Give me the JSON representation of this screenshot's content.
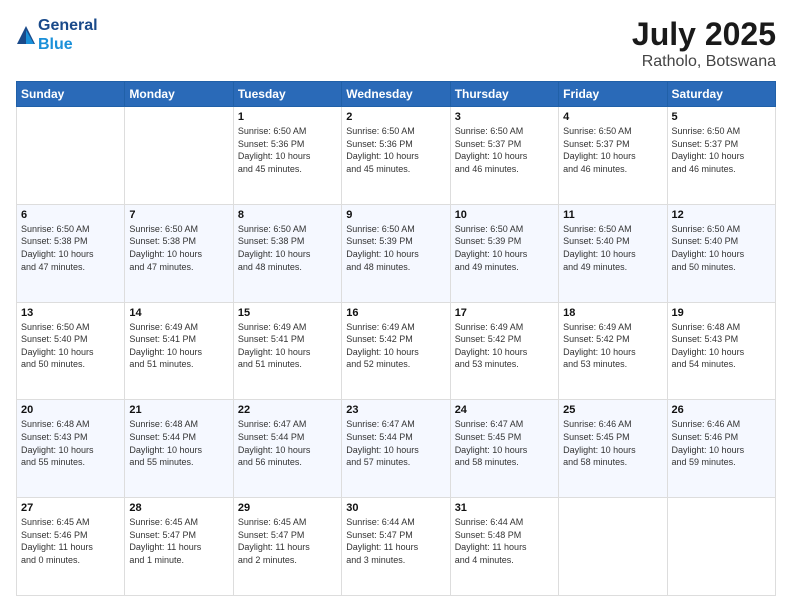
{
  "header": {
    "logo_line1": "General",
    "logo_line2": "Blue",
    "month": "July 2025",
    "location": "Ratholo, Botswana"
  },
  "days_of_week": [
    "Sunday",
    "Monday",
    "Tuesday",
    "Wednesday",
    "Thursday",
    "Friday",
    "Saturday"
  ],
  "weeks": [
    [
      {
        "day": "",
        "info": ""
      },
      {
        "day": "",
        "info": ""
      },
      {
        "day": "1",
        "info": "Sunrise: 6:50 AM\nSunset: 5:36 PM\nDaylight: 10 hours\nand 45 minutes."
      },
      {
        "day": "2",
        "info": "Sunrise: 6:50 AM\nSunset: 5:36 PM\nDaylight: 10 hours\nand 45 minutes."
      },
      {
        "day": "3",
        "info": "Sunrise: 6:50 AM\nSunset: 5:37 PM\nDaylight: 10 hours\nand 46 minutes."
      },
      {
        "day": "4",
        "info": "Sunrise: 6:50 AM\nSunset: 5:37 PM\nDaylight: 10 hours\nand 46 minutes."
      },
      {
        "day": "5",
        "info": "Sunrise: 6:50 AM\nSunset: 5:37 PM\nDaylight: 10 hours\nand 46 minutes."
      }
    ],
    [
      {
        "day": "6",
        "info": "Sunrise: 6:50 AM\nSunset: 5:38 PM\nDaylight: 10 hours\nand 47 minutes."
      },
      {
        "day": "7",
        "info": "Sunrise: 6:50 AM\nSunset: 5:38 PM\nDaylight: 10 hours\nand 47 minutes."
      },
      {
        "day": "8",
        "info": "Sunrise: 6:50 AM\nSunset: 5:38 PM\nDaylight: 10 hours\nand 48 minutes."
      },
      {
        "day": "9",
        "info": "Sunrise: 6:50 AM\nSunset: 5:39 PM\nDaylight: 10 hours\nand 48 minutes."
      },
      {
        "day": "10",
        "info": "Sunrise: 6:50 AM\nSunset: 5:39 PM\nDaylight: 10 hours\nand 49 minutes."
      },
      {
        "day": "11",
        "info": "Sunrise: 6:50 AM\nSunset: 5:40 PM\nDaylight: 10 hours\nand 49 minutes."
      },
      {
        "day": "12",
        "info": "Sunrise: 6:50 AM\nSunset: 5:40 PM\nDaylight: 10 hours\nand 50 minutes."
      }
    ],
    [
      {
        "day": "13",
        "info": "Sunrise: 6:50 AM\nSunset: 5:40 PM\nDaylight: 10 hours\nand 50 minutes."
      },
      {
        "day": "14",
        "info": "Sunrise: 6:49 AM\nSunset: 5:41 PM\nDaylight: 10 hours\nand 51 minutes."
      },
      {
        "day": "15",
        "info": "Sunrise: 6:49 AM\nSunset: 5:41 PM\nDaylight: 10 hours\nand 51 minutes."
      },
      {
        "day": "16",
        "info": "Sunrise: 6:49 AM\nSunset: 5:42 PM\nDaylight: 10 hours\nand 52 minutes."
      },
      {
        "day": "17",
        "info": "Sunrise: 6:49 AM\nSunset: 5:42 PM\nDaylight: 10 hours\nand 53 minutes."
      },
      {
        "day": "18",
        "info": "Sunrise: 6:49 AM\nSunset: 5:42 PM\nDaylight: 10 hours\nand 53 minutes."
      },
      {
        "day": "19",
        "info": "Sunrise: 6:48 AM\nSunset: 5:43 PM\nDaylight: 10 hours\nand 54 minutes."
      }
    ],
    [
      {
        "day": "20",
        "info": "Sunrise: 6:48 AM\nSunset: 5:43 PM\nDaylight: 10 hours\nand 55 minutes."
      },
      {
        "day": "21",
        "info": "Sunrise: 6:48 AM\nSunset: 5:44 PM\nDaylight: 10 hours\nand 55 minutes."
      },
      {
        "day": "22",
        "info": "Sunrise: 6:47 AM\nSunset: 5:44 PM\nDaylight: 10 hours\nand 56 minutes."
      },
      {
        "day": "23",
        "info": "Sunrise: 6:47 AM\nSunset: 5:44 PM\nDaylight: 10 hours\nand 57 minutes."
      },
      {
        "day": "24",
        "info": "Sunrise: 6:47 AM\nSunset: 5:45 PM\nDaylight: 10 hours\nand 58 minutes."
      },
      {
        "day": "25",
        "info": "Sunrise: 6:46 AM\nSunset: 5:45 PM\nDaylight: 10 hours\nand 58 minutes."
      },
      {
        "day": "26",
        "info": "Sunrise: 6:46 AM\nSunset: 5:46 PM\nDaylight: 10 hours\nand 59 minutes."
      }
    ],
    [
      {
        "day": "27",
        "info": "Sunrise: 6:45 AM\nSunset: 5:46 PM\nDaylight: 11 hours\nand 0 minutes."
      },
      {
        "day": "28",
        "info": "Sunrise: 6:45 AM\nSunset: 5:47 PM\nDaylight: 11 hours\nand 1 minute."
      },
      {
        "day": "29",
        "info": "Sunrise: 6:45 AM\nSunset: 5:47 PM\nDaylight: 11 hours\nand 2 minutes."
      },
      {
        "day": "30",
        "info": "Sunrise: 6:44 AM\nSunset: 5:47 PM\nDaylight: 11 hours\nand 3 minutes."
      },
      {
        "day": "31",
        "info": "Sunrise: 6:44 AM\nSunset: 5:48 PM\nDaylight: 11 hours\nand 4 minutes."
      },
      {
        "day": "",
        "info": ""
      },
      {
        "day": "",
        "info": ""
      }
    ]
  ]
}
